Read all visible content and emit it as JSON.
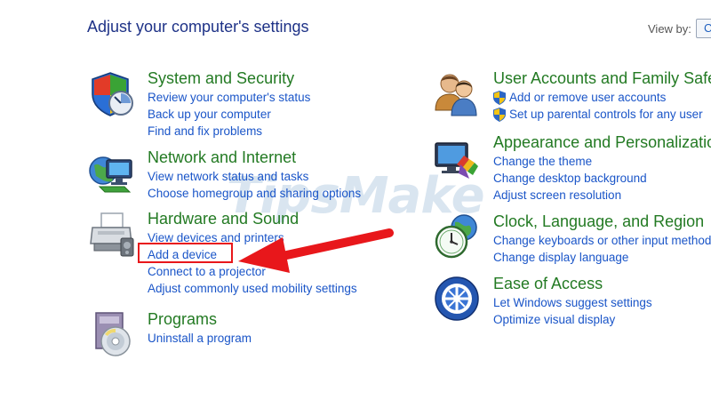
{
  "header": {
    "title": "Adjust your computer's settings",
    "view_by_label": "View by:",
    "view_by_value": "C"
  },
  "left_column": {
    "system_security": {
      "title": "System and Security",
      "icon": "shield-icon",
      "links": [
        "Review your computer's status",
        "Back up your computer",
        "Find and fix problems"
      ]
    },
    "network_internet": {
      "title": "Network and Internet",
      "icon": "network-globe-icon",
      "links": [
        "View network status and tasks",
        "Choose homegroup and sharing options"
      ]
    },
    "hardware_sound": {
      "title": "Hardware and Sound",
      "icon": "printer-icon",
      "links": [
        "View devices and printers",
        "Add a device",
        "Connect to a projector",
        "Adjust commonly used mobility settings"
      ]
    },
    "programs": {
      "title": "Programs",
      "icon": "programs-disc-icon",
      "links": [
        "Uninstall a program"
      ]
    }
  },
  "right_column": {
    "user_accounts": {
      "title": "User Accounts and Family Safety",
      "icon": "users-icon",
      "links": [
        "Add or remove user accounts",
        "Set up parental controls for any user"
      ]
    },
    "appearance": {
      "title": "Appearance and Personalization",
      "icon": "monitor-paint-icon",
      "links": [
        "Change the theme",
        "Change desktop background",
        "Adjust screen resolution"
      ]
    },
    "clock_language": {
      "title": "Clock, Language, and Region",
      "icon": "clock-globe-icon",
      "links": [
        "Change keyboards or other input methods",
        "Change display language"
      ]
    },
    "ease_of_access": {
      "title": "Ease of Access",
      "icon": "ease-of-access-icon",
      "links": [
        "Let Windows suggest settings",
        "Optimize visual display"
      ]
    }
  },
  "watermark": "TipsMake",
  "colors": {
    "title_blue": "#1e3287",
    "category_green": "#237a23",
    "link_blue": "#1a55c8",
    "annotation_red": "#e8171b"
  }
}
